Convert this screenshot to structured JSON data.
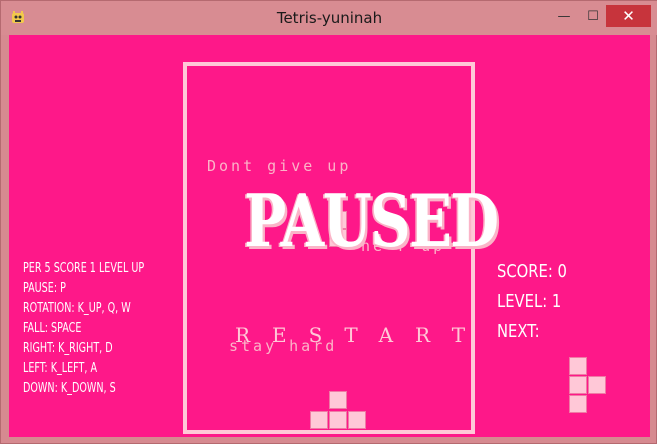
{
  "window": {
    "title": "Tetris-yuninah",
    "controls": {
      "minimize": "—",
      "maximize": "☐",
      "close": "✕"
    }
  },
  "board": {
    "background_text": [
      "Dont give up",
      "he r up",
      "stay hard"
    ],
    "paused_label": "PAUSED",
    "restart_label": "RESTART"
  },
  "instructions": [
    "PER 5 SCORE 1 LEVEL UP",
    "PAUSE: P",
    "ROTATION: K_UP, Q, W",
    "FALL: SPACE",
    "RIGHT: K_RIGHT, D",
    "LEFT: K_LEFT, A",
    "DOWN: K_DOWN, S"
  ],
  "stats": {
    "score": "SCORE: 0",
    "level": "LEVEL: 1",
    "next": "NEXT:"
  },
  "colors": {
    "background": "#fe1889",
    "block": "#ffc8d7",
    "text": "#ffffff",
    "close_button": "#c7343c"
  }
}
